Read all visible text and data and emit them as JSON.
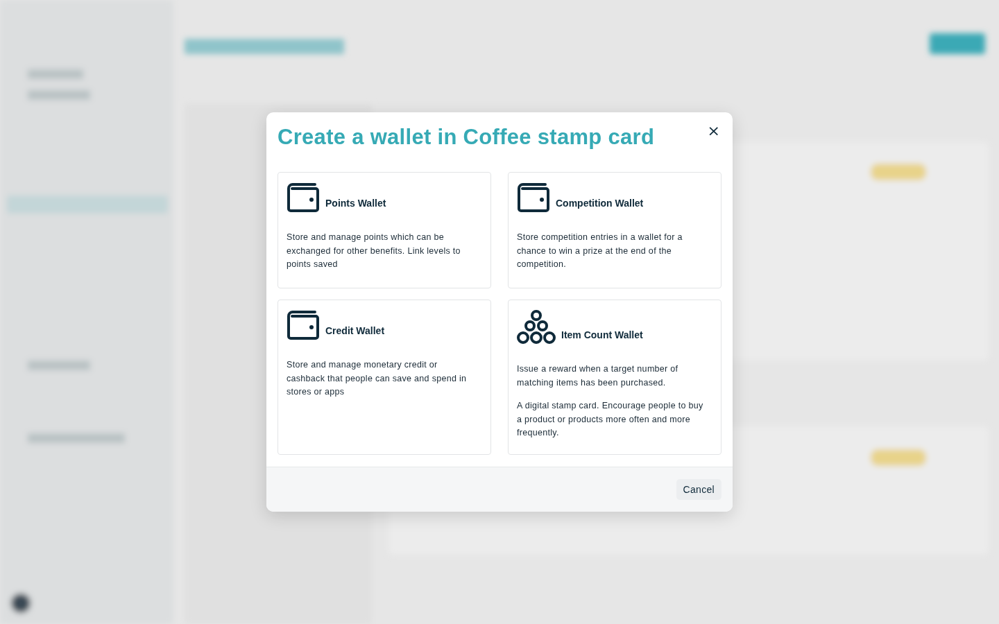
{
  "dialog": {
    "title": "Create a wallet in Coffee stamp card",
    "close": "×",
    "options": [
      {
        "kind": "wallet",
        "name": "Points Wallet",
        "paragraphs": [
          "Store and manage points which can be exchanged for other benefits. Link levels to points saved"
        ]
      },
      {
        "kind": "wallet",
        "name": "Competition Wallet",
        "paragraphs": [
          "Store competition entries in a wallet for a chance to win a prize at the end of the competition."
        ]
      },
      {
        "kind": "wallet",
        "name": "Credit Wallet",
        "paragraphs": [
          "Store and manage monetary credit or cashback that people can save and spend in stores or apps"
        ]
      },
      {
        "kind": "stack",
        "name": "Item Count Wallet",
        "paragraphs": [
          "Issue a reward when a target number of matching items has been purchased.",
          "A digital stamp card. Encourage people to buy a product or products more often and more frequently."
        ]
      }
    ],
    "buttons": [
      "Cancel"
    ]
  }
}
